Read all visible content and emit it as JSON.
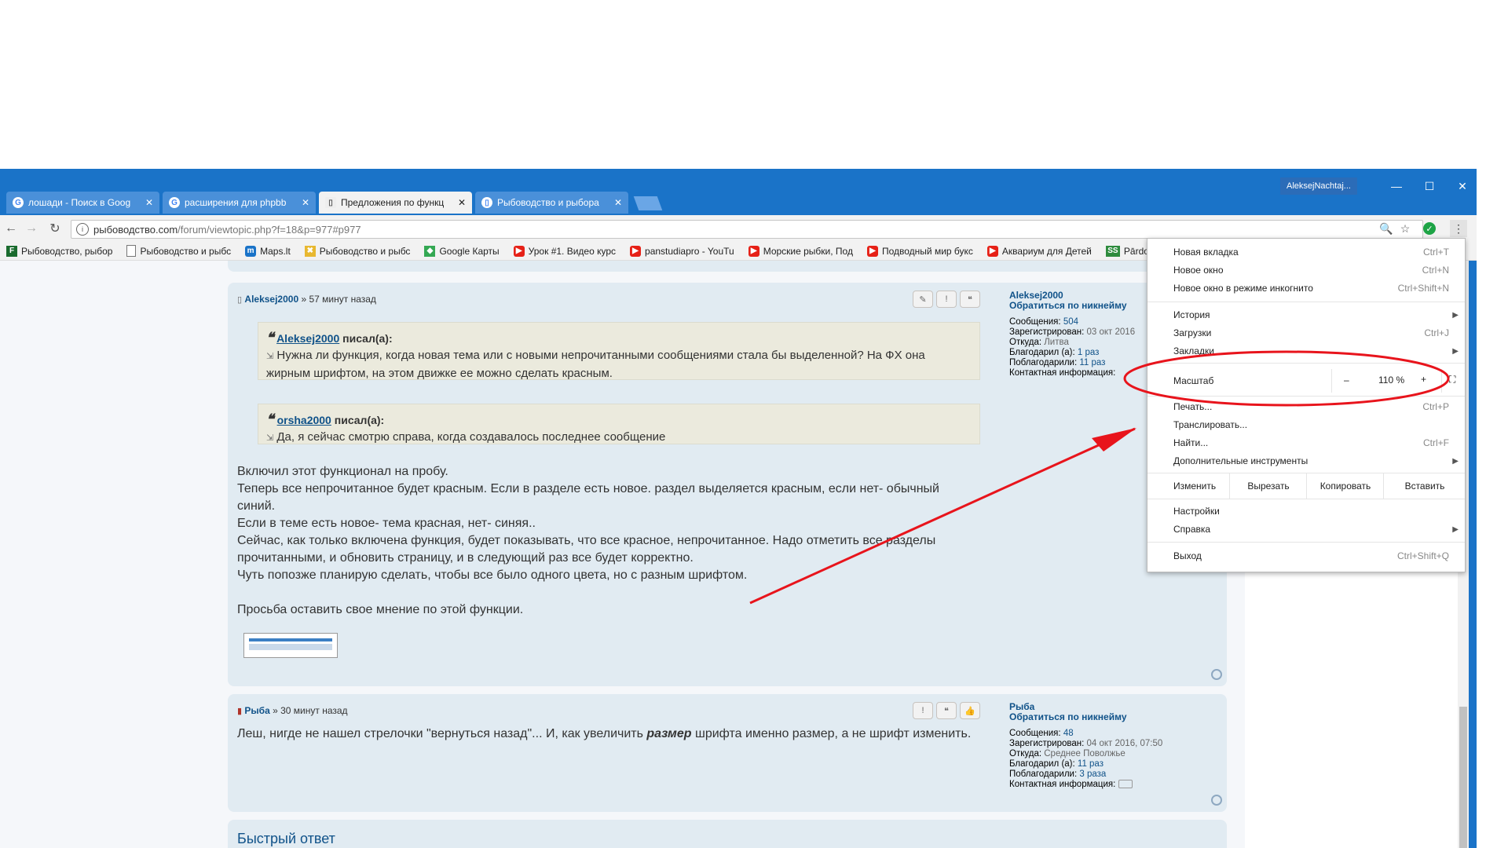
{
  "window": {
    "profile": "AleksejNachtaj...",
    "minimize": "—",
    "maximize": "☐",
    "close": "✕"
  },
  "tabs": [
    {
      "title": "лошади - Поиск в Goog",
      "icon": "G",
      "active": false
    },
    {
      "title": "расширения для phpbb",
      "icon": "G",
      "active": false
    },
    {
      "title": "Предложения по функц",
      "icon": "📄",
      "active": true
    },
    {
      "title": "Рыбоводство и рыбора",
      "icon": "📄",
      "active": false
    }
  ],
  "toolbar": {
    "url_host": "рыбоводство.com",
    "url_path": "/forum/viewtopic.php?f=18&p=977#p977"
  },
  "bookmarks": [
    {
      "label": "Рыбоводство, рыбор",
      "icon": "F",
      "color": "#1a6b2e"
    },
    {
      "label": "Рыбоводство и рыбс",
      "icon": "📄",
      "color": "#ffffff"
    },
    {
      "label": "Maps.lt",
      "icon": "m",
      "color": "#1a73c8"
    },
    {
      "label": "Рыбоводство и рыбс",
      "icon": "✖",
      "color": "#e8b830"
    },
    {
      "label": "Google Карты",
      "icon": "◆",
      "color": "#34a853"
    },
    {
      "label": "Урок #1. Видео курс",
      "icon": "▶",
      "color": "#e62117"
    },
    {
      "label": "panstudiapro - YouTu",
      "icon": "▶",
      "color": "#e62117"
    },
    {
      "label": "Морские рыбки, Под",
      "icon": "▶",
      "color": "#e62117"
    },
    {
      "label": "Подводный мир букс",
      "icon": "▶",
      "color": "#e62117"
    },
    {
      "label": "Аквариум для Детей",
      "icon": "▶",
      "color": "#e62117"
    },
    {
      "label": "Pārdodar",
      "icon": "SS",
      "color": "#2e8b3d"
    }
  ],
  "post1": {
    "author": "Aleksej2000",
    "time": "» 57 минут назад",
    "quote1_author": "Aleksej2000",
    "quote1_wrote": "писал(а):",
    "quote1_text": "Нужна ли функция, когда новая тема или с новыми непрочитанными сообщениями стала бы выделенной? На ФХ она жирным шрифтом, на этом движке ее можно сделать красным.",
    "quote2_author": "orsha2000",
    "quote2_wrote": "писал(а):",
    "quote2_text": "Да, я сейчас смотрю справа, когда создавалось последнее сообщение",
    "lines": [
      "Включил этот функционал на пробу.",
      "Теперь все непрочитанное будет красным. Если в разделе есть новое. раздел выделяется красным, если нет- обычный",
      "синий.",
      "Если в теме есть новое- тема красная, нет- синяя..",
      "Сейчас, как только включена функция, будет показывать, что все красное, непрочитанное. Надо отметить все разделы",
      "прочитанными, и обновить страницу, и в следующий раз все будет корректно.",
      "Чуть попозже планирую сделать, чтобы все было одного цвета, но с разным шрифтом.",
      "",
      "Просьба оставить свое мнение по этой функции."
    ],
    "profile": {
      "name": "Aleksej2000",
      "pm": "Обратиться по никнейму",
      "posts_label": "Сообщения:",
      "posts": "504",
      "reg_label": "Зарегистрирован:",
      "reg": "03 окт 2016",
      "from_label": "Откуда:",
      "from": "Литва",
      "thanked_label": "Благодарил (а):",
      "thanked": "1 раз",
      "thanks_label": "Поблагодарили:",
      "thanks": "11 раз",
      "contact_label": "Контактная информация:"
    }
  },
  "post2": {
    "author": "Рыба",
    "time": "» 30 минут назад",
    "text_a": "Леш, нигде не нашел стрелочки \"вернуться назад\"... И, как увеличить ",
    "text_b": "размер",
    "text_c": " шрифта именно размер, а не шрифт изменить.",
    "profile": {
      "name": "Рыба",
      "pm": "Обратиться по никнейму",
      "posts_label": "Сообщения:",
      "posts": "48",
      "reg_label": "Зарегистрирован:",
      "reg": "04 окт 2016, 07:50",
      "from_label": "Откуда:",
      "from": "Среднее Поволжье",
      "thanked_label": "Благодарил (а):",
      "thanked": "11 раз",
      "thanks_label": "Поблагодарили:",
      "thanks": "3 раза",
      "contact_label": "Контактная информация:"
    }
  },
  "quick_reply": "Быстрый ответ",
  "menu": {
    "new_tab": "Новая вкладка",
    "new_tab_sc": "Ctrl+T",
    "new_window": "Новое окно",
    "new_window_sc": "Ctrl+N",
    "incognito": "Новое окно в режиме инкогнито",
    "incognito_sc": "Ctrl+Shift+N",
    "history": "История",
    "downloads": "Загрузки",
    "downloads_sc": "Ctrl+J",
    "bookmarks": "Закладки",
    "zoom": "Масштаб",
    "zoom_minus": "–",
    "zoom_value": "110 %",
    "zoom_plus": "+",
    "print": "Печать...",
    "print_sc": "Ctrl+P",
    "cast": "Транслировать...",
    "find": "Найти...",
    "find_sc": "Ctrl+F",
    "more_tools": "Дополнительные инструменты",
    "edit": "Изменить",
    "cut": "Вырезать",
    "copy": "Копировать",
    "paste": "Вставить",
    "settings": "Настройки",
    "help": "Справка",
    "exit": "Выход",
    "exit_sc": "Ctrl+Shift+Q"
  },
  "annotation_color": "#e8141c"
}
